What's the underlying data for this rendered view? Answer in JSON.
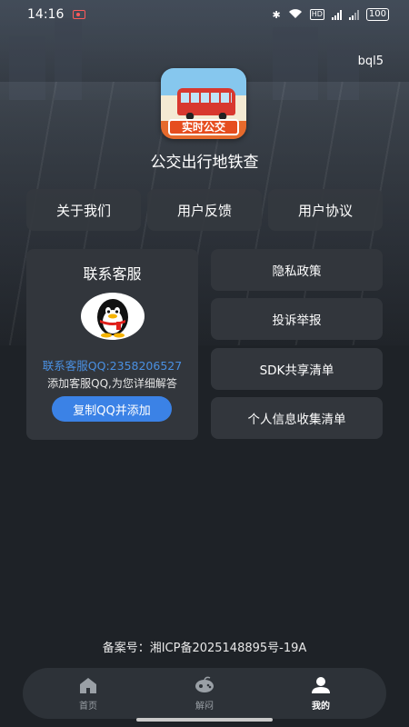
{
  "status_bar": {
    "time": "14:16",
    "hd_label": "HD",
    "battery": "100"
  },
  "version_tag": "bql5",
  "app": {
    "icon_badge": "实时公交",
    "title": "公交出行地铁查"
  },
  "top_buttons": [
    {
      "label": "关于我们"
    },
    {
      "label": "用户反馈"
    },
    {
      "label": "用户协议"
    }
  ],
  "contact": {
    "title": "联系客服",
    "qq_number": "联系客服QQ:2358206527",
    "description": "添加客服QQ,为您详细解答",
    "copy_button": "复制QQ并添加"
  },
  "side_buttons": [
    {
      "label": "隐私政策"
    },
    {
      "label": "投诉举报"
    },
    {
      "label": "SDK共享清单"
    },
    {
      "label": "个人信息收集清单"
    }
  ],
  "icp": "备案号：湘ICP备2025148895号-19A",
  "bottom_nav": [
    {
      "label": "首页",
      "icon": "home-icon",
      "active": false
    },
    {
      "label": "解闷",
      "icon": "game-icon",
      "active": false
    },
    {
      "label": "我的",
      "icon": "person-icon",
      "active": true
    }
  ],
  "colors": {
    "accent": "#3b82e6",
    "qq_text": "#4a90e2",
    "card_bg": "#32363c",
    "page_bg": "#1e2227"
  }
}
